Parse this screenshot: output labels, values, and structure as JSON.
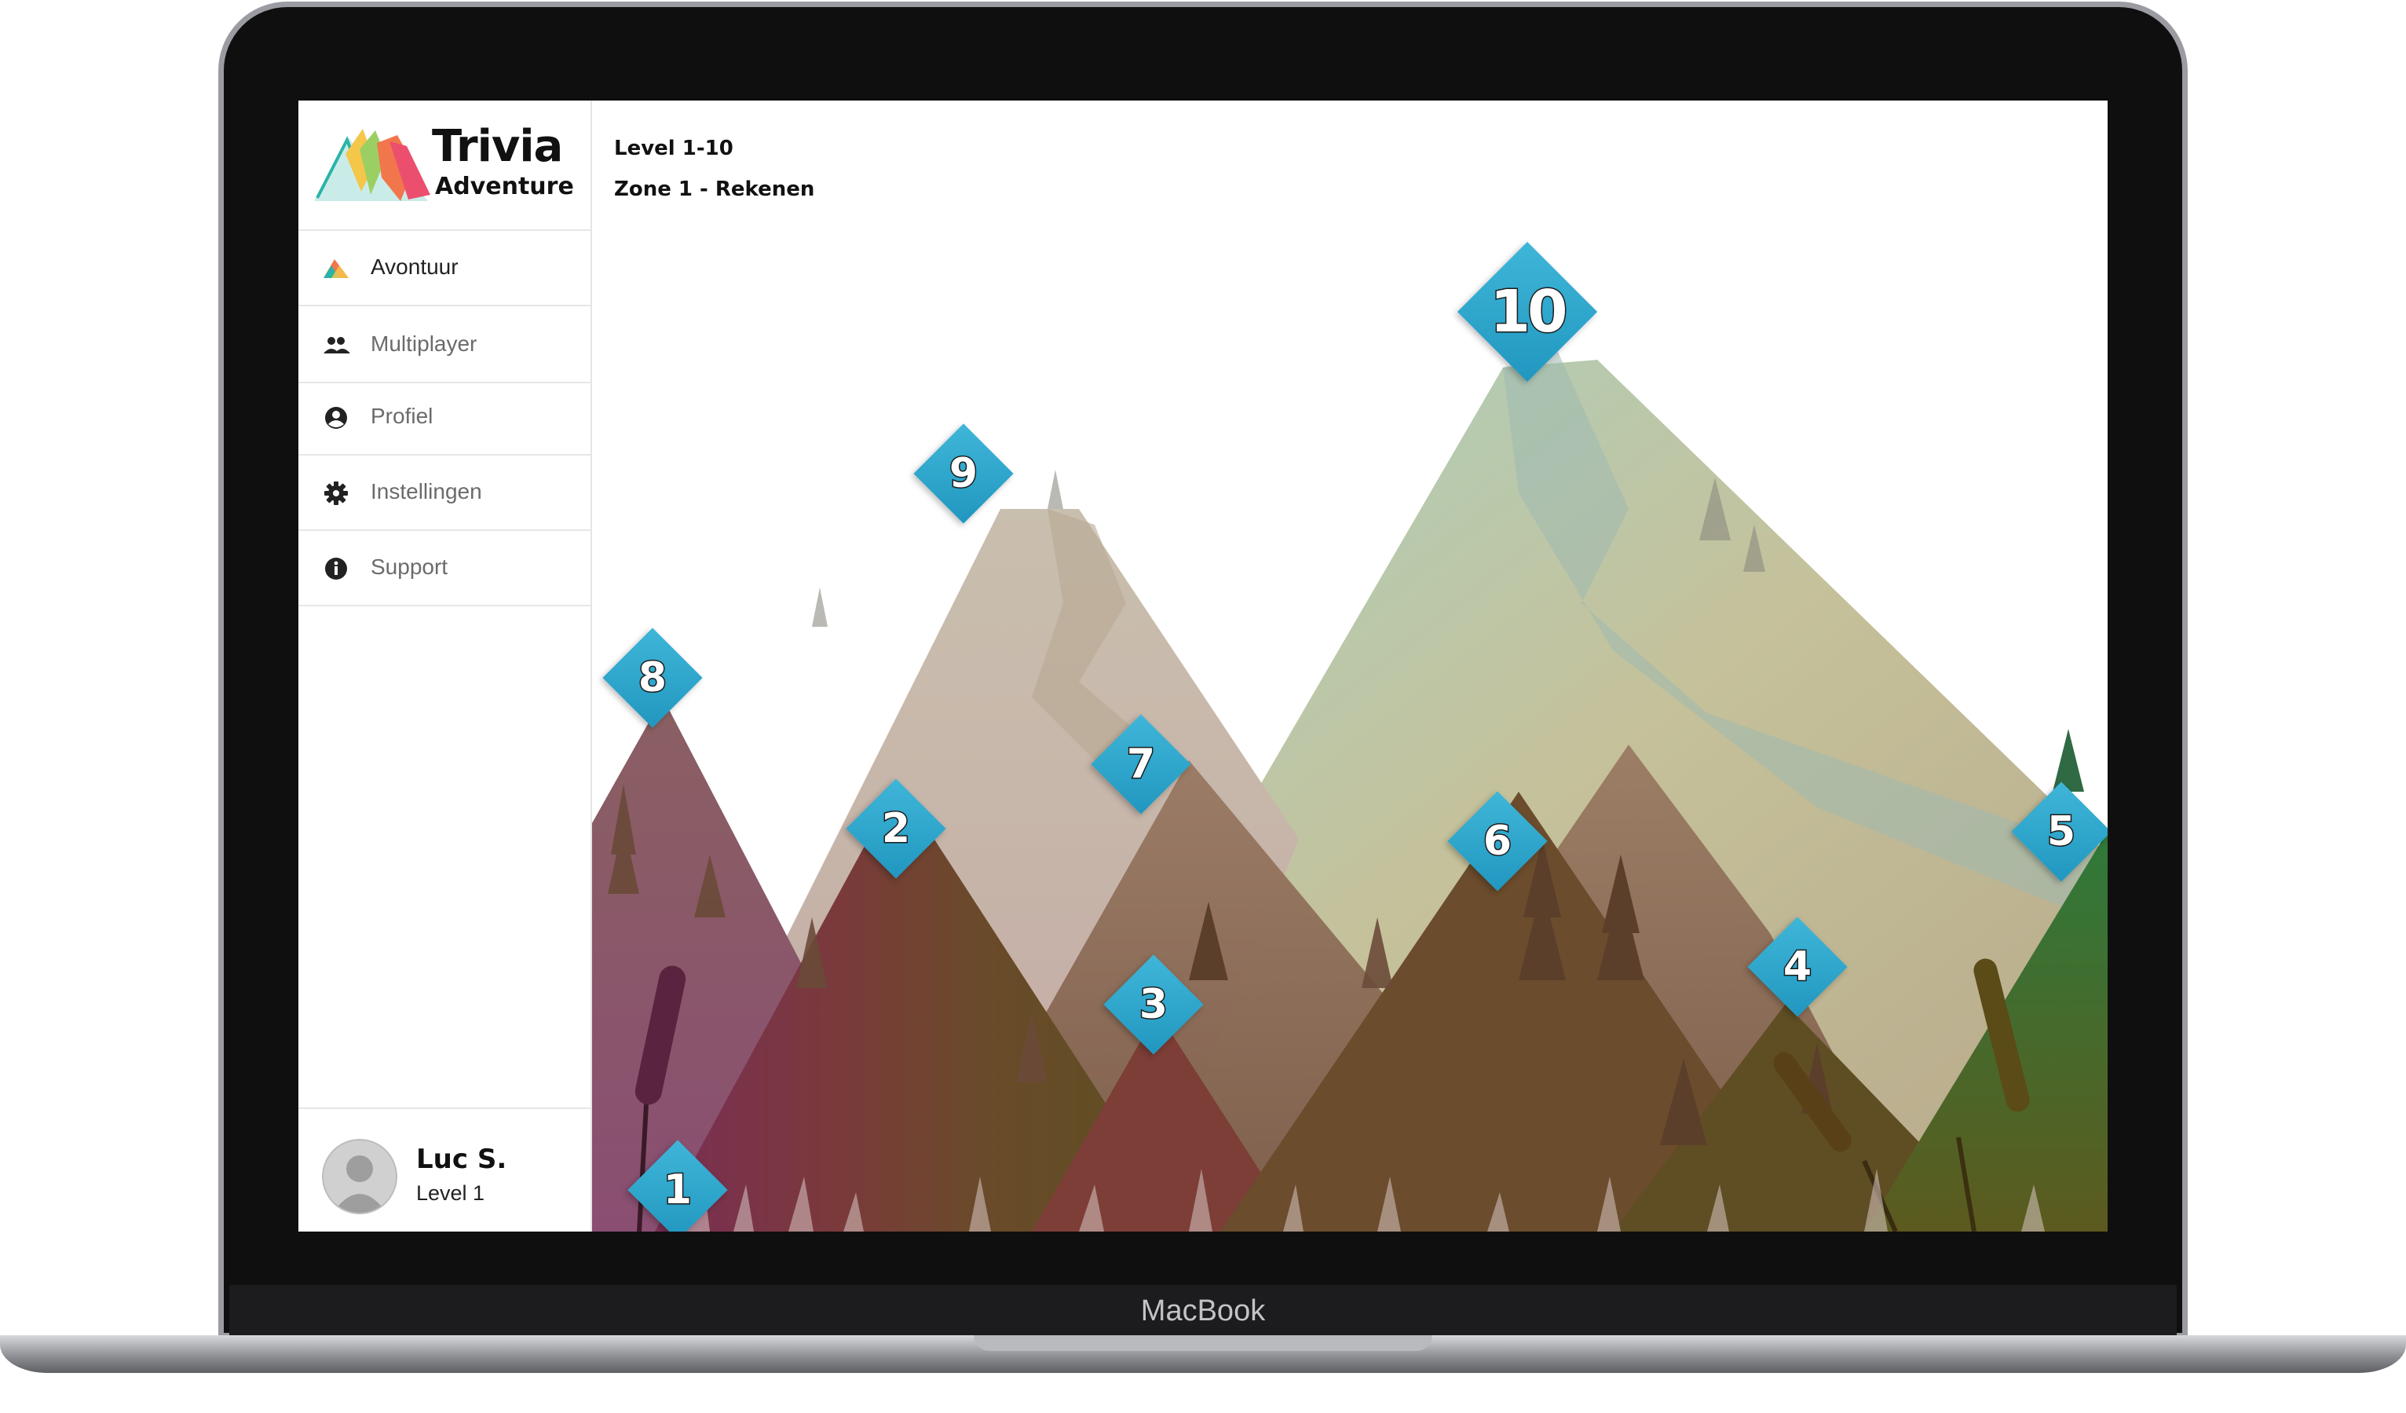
{
  "device": {
    "label": "MacBook"
  },
  "app": {
    "logo_title": "Trivia",
    "logo_subtitle": "Adventure"
  },
  "sidebar": {
    "items": [
      {
        "label": "Avontuur",
        "icon": "mountain-icon",
        "active": true
      },
      {
        "label": "Multiplayer",
        "icon": "group-icon",
        "active": false
      },
      {
        "label": "Profiel",
        "icon": "user-circle-icon",
        "active": false
      },
      {
        "label": "Instellingen",
        "icon": "gear-icon",
        "active": false
      },
      {
        "label": "Support",
        "icon": "info-icon",
        "active": false
      }
    ]
  },
  "user": {
    "name": "Luc S.",
    "level": "Level 1"
  },
  "map": {
    "level_range": "Level 1-10",
    "zone": "Zone 1 - Rekenen",
    "levels": [
      "1",
      "2",
      "3",
      "4",
      "5",
      "6",
      "7",
      "8",
      "9",
      "10"
    ]
  },
  "colors": {
    "node": "#2aa7cf",
    "accent_orange": "#f2764b",
    "accent_teal": "#2bb3a8"
  }
}
